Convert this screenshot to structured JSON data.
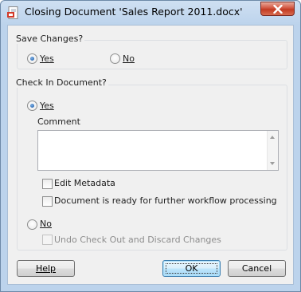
{
  "window": {
    "title": "Closing Document 'Sales Report 2011.docx'",
    "app_icon": "office-document-icon",
    "close_icon": "close-icon"
  },
  "save_changes": {
    "title": "Save Changes?",
    "options": [
      {
        "label": "Yes",
        "checked": true
      },
      {
        "label": "No",
        "checked": false
      }
    ]
  },
  "check_in": {
    "title": "Check In Document?",
    "yes_label": "Yes",
    "yes_checked": true,
    "comment_label": "Comment",
    "comment_value": "",
    "edit_metadata_label": "Edit Metadata",
    "edit_metadata_checked": false,
    "workflow_label": "Document is ready for further workflow processing",
    "workflow_checked": false,
    "no_label": "No",
    "no_checked": false,
    "undo_label": "Undo Check Out and Discard Changes",
    "undo_checked": false,
    "undo_disabled": true
  },
  "buttons": {
    "help": "Help",
    "ok": "OK",
    "cancel": "Cancel"
  },
  "colors": {
    "accent": "#1d5ba8",
    "close_button": "#c23a22",
    "titlebar": "#bcd3ec"
  }
}
